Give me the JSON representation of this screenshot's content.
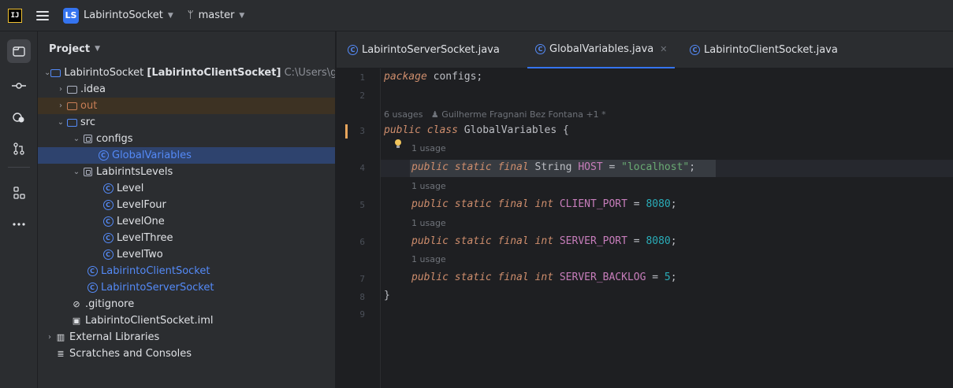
{
  "titlebar": {
    "logo": "IJ",
    "project_badge": "LS",
    "project_name": "LabirintoSocket",
    "branch_icon": "branch-icon",
    "branch": "master",
    "chevron": "⌄"
  },
  "toolstrip": {
    "items": [
      {
        "name": "project-view-icon"
      },
      {
        "name": "commit-icon"
      },
      {
        "name": "plugins-icon"
      },
      {
        "name": "pull-requests-icon"
      },
      {
        "name": "structure-icon"
      },
      {
        "name": "more-icon"
      }
    ]
  },
  "project_panel": {
    "title": "Project",
    "tree": [
      {
        "label": "LabirintoSocket",
        "suffix": "[LabirintoClientSocket]",
        "path": "C:\\Users\\g"
      },
      {
        "label": ".idea"
      },
      {
        "label": "out"
      },
      {
        "label": "src"
      },
      {
        "label": "configs"
      },
      {
        "label": "GlobalVariables"
      },
      {
        "label": "LabirintsLevels"
      },
      {
        "label": "Level"
      },
      {
        "label": "LevelFour"
      },
      {
        "label": "LevelOne"
      },
      {
        "label": "LevelThree"
      },
      {
        "label": "LevelTwo"
      },
      {
        "label": "LabirintoClientSocket"
      },
      {
        "label": "LabirintoServerSocket"
      },
      {
        "label": ".gitignore"
      },
      {
        "label": "LabirintoClientSocket.iml"
      },
      {
        "label": "External Libraries"
      },
      {
        "label": "Scratches and Consoles"
      }
    ]
  },
  "tabs": [
    {
      "label": "LabirintoServerSocket.java",
      "active": false
    },
    {
      "label": "GlobalVariables.java",
      "active": true
    },
    {
      "label": "LabirintoClientSocket.java",
      "active": false
    }
  ],
  "editor": {
    "line_numbers": [
      "1",
      "2",
      "3",
      "4",
      "5",
      "6",
      "7",
      "8",
      "9"
    ],
    "hints": {
      "class_usages": "6 usages",
      "author": "Guilherme Fragnani Bez Fontana +1 *",
      "usage": "1 usage"
    },
    "code": {
      "l1_kw": "package",
      "l1_rest": " configs;",
      "l3_kw": "public class",
      "l3_rest": " GlobalVariables {",
      "mods": "public static final",
      "string_type": " String ",
      "int_type": " int",
      "host_name": "HOST",
      "host_value": "\"localhost\"",
      "client_port_name": "CLIENT_PORT",
      "server_port_name": "SERVER_PORT",
      "server_backlog_name": "SERVER_BACKLOG",
      "port_value": "8080",
      "backlog_value": "5",
      "eq": " = ",
      "semi": ";",
      "close_brace": "}"
    }
  }
}
